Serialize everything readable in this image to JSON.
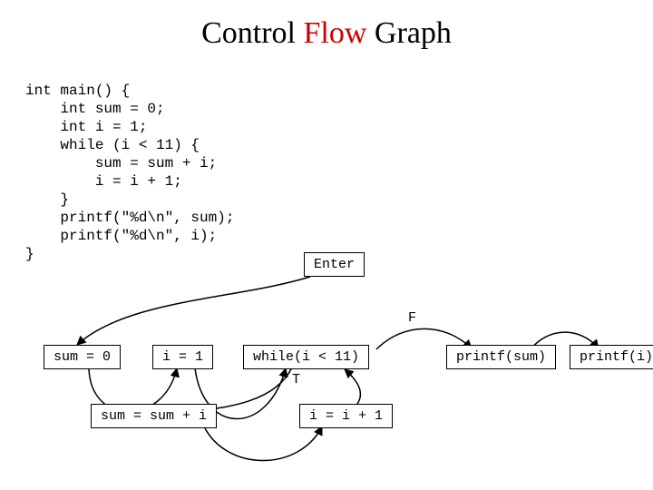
{
  "title": {
    "pre": "Control ",
    "flow": "Flow",
    "post": " Graph"
  },
  "code": "int main() {\n    int sum = 0;\n    int i = 1;\n    while (i < 11) {\n        sum = sum + i;\n        i = i + 1;\n    }\n    printf(\"%d\\n\", sum);\n    printf(\"%d\\n\", i);\n}",
  "nodes": {
    "enter": "Enter",
    "sum0": "sum = 0",
    "i1": "i = 1",
    "while": "while(i < 11)",
    "printfsum": "printf(sum)",
    "printfi": "printf(i)",
    "sumsumi": "sum = sum + i",
    "ii1": "i = i + 1"
  },
  "labels": {
    "F": "F",
    "T": "T"
  }
}
